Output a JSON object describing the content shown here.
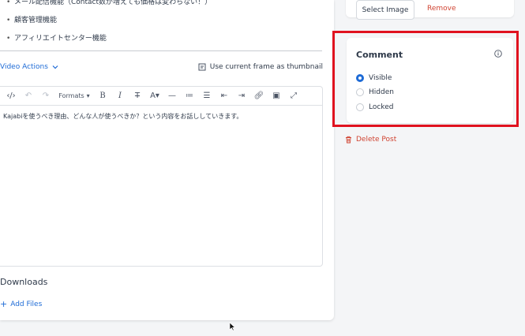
{
  "features": [
    "メール配信機能（Contact数が増えても価格は変わらない！）",
    "顧客管理機能",
    "アフィリエイトセンター機能"
  ],
  "video_actions": {
    "label": "Video Actions"
  },
  "thumbnail": {
    "label": "Use current frame as thumbnail"
  },
  "editor": {
    "toolbar": {
      "formats_label": "Formats"
    },
    "content": "Kajabiを使うべき理由、どんな人が使うべきか？という内容をお話ししていきます。"
  },
  "downloads": {
    "title": "Downloads",
    "add_files_label": "Add Files"
  },
  "image_section": {
    "select_label": "Select Image",
    "remove_label": "Remove"
  },
  "comment": {
    "title": "Comment",
    "options": [
      "Visible",
      "Hidden",
      "Locked"
    ],
    "selected": "Visible"
  },
  "delete_post": {
    "label": "Delete Post"
  },
  "colors": {
    "accent": "#1e6bd6",
    "danger": "#d04432",
    "highlight": "#e0121f"
  }
}
